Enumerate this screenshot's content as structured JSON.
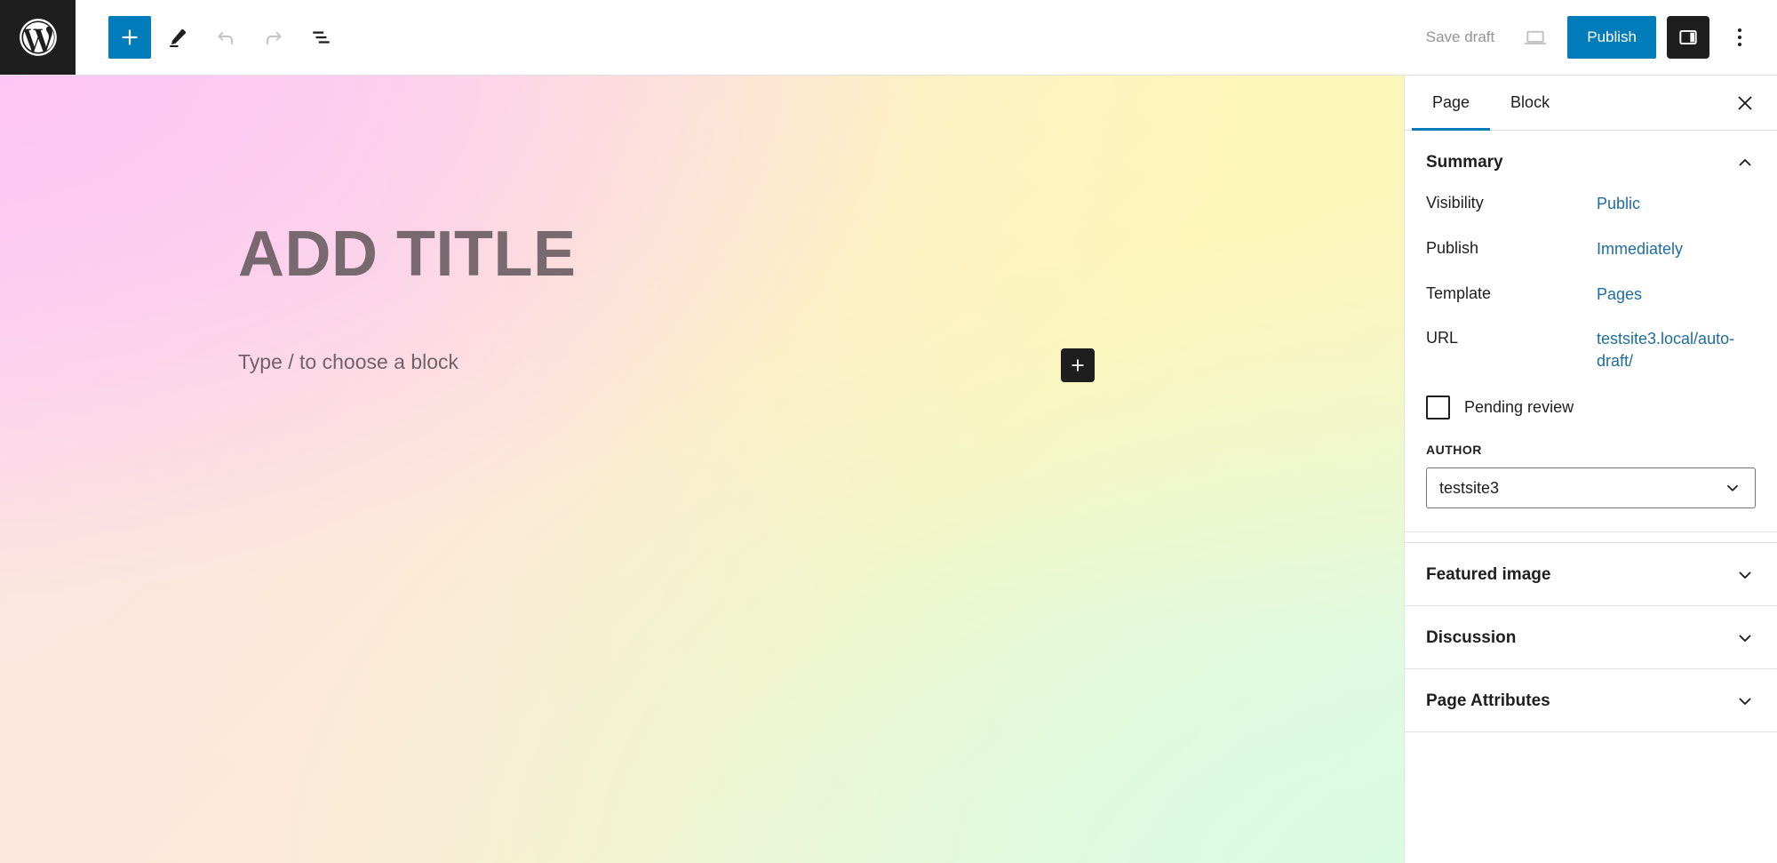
{
  "header": {
    "logo_icon": "wordpress-logo-icon",
    "tools": [
      {
        "name": "block-inserter-button",
        "icon": "plus-icon",
        "label": "Toggle block inserter",
        "state": "primary"
      },
      {
        "name": "tools-pencil-button",
        "icon": "pencil-icon",
        "label": "Tools",
        "state": "active"
      },
      {
        "name": "undo-button",
        "icon": "undo-arrow-icon",
        "label": "Undo",
        "state": "disabled"
      },
      {
        "name": "redo-button",
        "icon": "redo-arrow-icon",
        "label": "Redo",
        "state": "disabled"
      },
      {
        "name": "document-overview-button",
        "icon": "list-view-icon",
        "label": "Document Overview",
        "state": "default"
      }
    ],
    "save_draft_label": "Save draft",
    "preview_icon": "laptop-preview-icon",
    "preview_label": "Preview",
    "publish_label": "Publish",
    "sidebar_toggle_icon": "settings-sidebar-icon",
    "sidebar_toggle_label": "Settings",
    "more_menu_icon": "three-vertical-dots-icon",
    "more_menu_label": "Options"
  },
  "editor": {
    "title_placeholder": "ADD TITLE",
    "block_placeholder": "Type / to choose a block",
    "inline_inserter_icon": "plus-icon",
    "inline_inserter_label": "Add block"
  },
  "sidebar": {
    "tabs": [
      {
        "label": "Page",
        "active": true
      },
      {
        "label": "Block",
        "active": false
      }
    ],
    "close_icon": "close-x-icon",
    "close_label": "Close settings",
    "summary": {
      "title": "Summary",
      "chevron_icon": "chevron-up-icon",
      "rows": [
        {
          "label": "Visibility",
          "value": "Public",
          "name": "visibility"
        },
        {
          "label": "Publish",
          "value": "Immediately",
          "name": "publish-date"
        },
        {
          "label": "Template",
          "value": "Pages",
          "name": "template"
        },
        {
          "label": "URL",
          "value": "testsite3.local/auto-draft/",
          "name": "url"
        }
      ],
      "pending_review_label": "Pending review",
      "pending_review_checked": false,
      "author_label": "AUTHOR",
      "author_value": "testsite3",
      "author_chevron_icon": "chevron-down-icon"
    },
    "panels": [
      {
        "title": "Featured image",
        "chevron_icon": "chevron-down-icon",
        "name": "featured-image"
      },
      {
        "title": "Discussion",
        "chevron_icon": "chevron-down-icon",
        "name": "discussion"
      },
      {
        "title": "Page Attributes",
        "chevron_icon": "chevron-down-icon",
        "name": "page-attributes"
      }
    ]
  },
  "colors": {
    "accent": "#007cba",
    "link": "#1e6d9c",
    "dark": "#1e1e1e",
    "muted": "#949494",
    "border": "#e0e0e0"
  }
}
